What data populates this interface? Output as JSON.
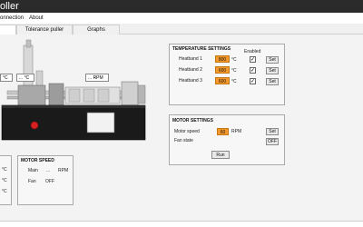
{
  "window": {
    "title": "oller"
  },
  "menu": [
    "onnection",
    "About"
  ],
  "tabs": [
    {
      "label": "",
      "active": true
    },
    {
      "label": "Tolerance puller",
      "active": false
    },
    {
      "label": "Graphs",
      "active": false
    }
  ],
  "overlay_readouts": {
    "temp_left": "°C",
    "temp_mid": "...",
    "temp_unit": "°C",
    "rpm_value": "...",
    "rpm_unit": "RPM"
  },
  "temperature_panel": {
    "partial_units": [
      "°C",
      "°C",
      "°C"
    ]
  },
  "motor_speed_panel": {
    "title": "MOTOR SPEED",
    "main_label": "Main",
    "main_value": "...",
    "main_unit": "RPM",
    "fan_label": "Fan",
    "fan_value": "OFF"
  },
  "temperature_settings": {
    "title": "TEMPERATURE SETTINGS",
    "enabled_header": "Enabled",
    "rows": [
      {
        "label": "Heatband 1",
        "value": "800",
        "unit": "°C",
        "enabled": true,
        "button": "Set"
      },
      {
        "label": "Heatband 2",
        "value": "600",
        "unit": "°C",
        "enabled": true,
        "button": "Set"
      },
      {
        "label": "Heatband 3",
        "value": "600",
        "unit": "°C",
        "enabled": true,
        "button": "Set"
      }
    ]
  },
  "motor_settings": {
    "title": "MOTOR SETTINGS",
    "speed_label": "Motor speed",
    "speed_value": "60",
    "speed_unit": "RPM",
    "set_button": "Set",
    "fan_label": "Fan state",
    "fan_button": "OFF",
    "run_button": "Run"
  },
  "colors": {
    "accent_value": "#f59a2a",
    "machine_body": "#1a1a1a",
    "estop": "#d42020"
  }
}
